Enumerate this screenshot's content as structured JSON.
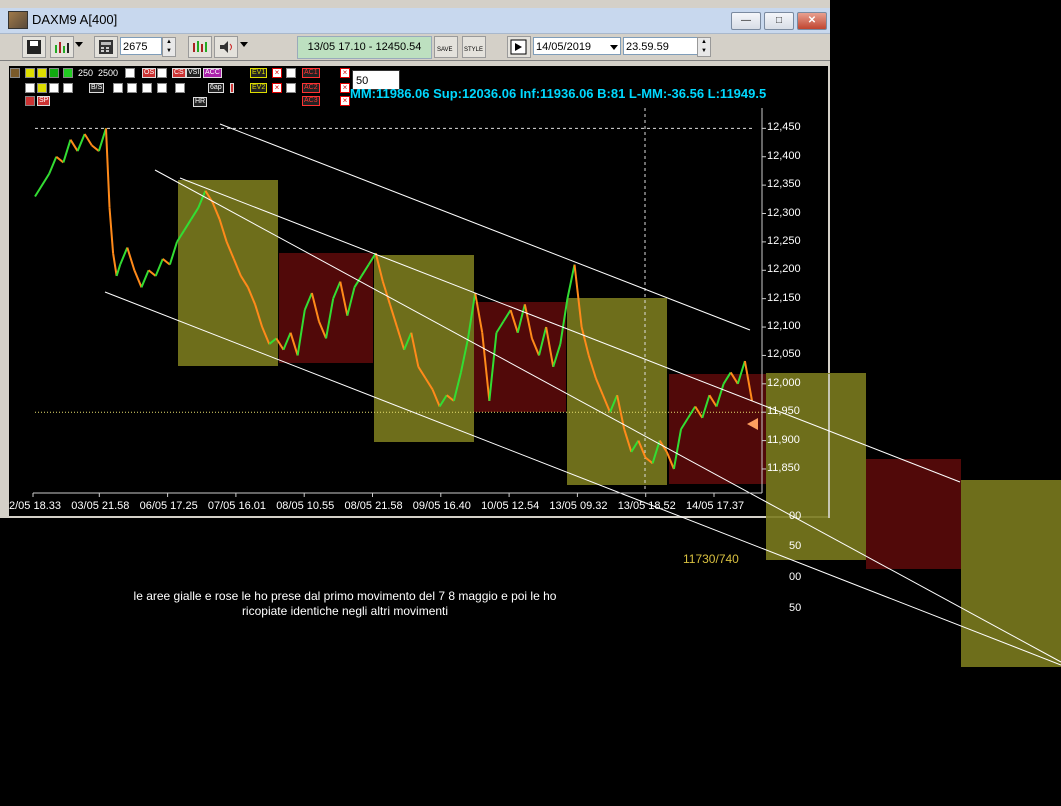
{
  "window": {
    "title": "DAXM9 A[400]",
    "min_label": "—",
    "max_label": "□",
    "close_label": "✕"
  },
  "toolbar": {
    "bars_value": "2675",
    "bar_info": "13/05 17.10 - 12450.54",
    "date_value": "14/05/2019",
    "time_value": "23.59.59",
    "save_label": "SAVE",
    "style_label": "STYLE"
  },
  "indicators": {
    "row1": [
      "250",
      "2500"
    ],
    "labels": [
      "OS",
      "CS",
      "68",
      "VSI",
      "ACC",
      "EV1",
      "AC1"
    ],
    "labels2": [
      "B/S",
      "6ap",
      "HR",
      "EV2",
      "AC2",
      "AC3",
      "SP"
    ],
    "period_value": "50"
  },
  "info_line": "MM:11986.06 Sup:12036.06 Inf:11936.06 B:81 L-MM:-36.56 L:11949.5",
  "annotation": {
    "line1": "le aree gialle e rose le ho prese dal primo movimento del 7 8 maggio e poi le ho",
    "line2": "ricopiate identiche negli altri movimenti"
  },
  "ratio_label": "11730/740",
  "extra_labels": [
    "00",
    "50",
    "00",
    "50"
  ],
  "colors": {
    "background": "#000000",
    "yellow_zone": "#7a7a1e",
    "red_zone": "#5a0a0a",
    "price_up": "#33dd33",
    "price_down": "#ff8a1a",
    "channel": "#ffffff",
    "info_text": "#00d8ff"
  },
  "chart_data": {
    "type": "line",
    "symbol": "DAXM9",
    "ylim": [
      11820,
      12470
    ],
    "y_ticks": [
      12450,
      12400,
      12350,
      12300,
      12250,
      12200,
      12150,
      12100,
      12050,
      12000,
      11950,
      11900,
      11850
    ],
    "y_tick_labels": [
      "12,450",
      "12,400",
      "12,350",
      "12,300",
      "12,250",
      "12,200",
      "12,150",
      "12,100",
      "12,050",
      "12,000",
      "11,950",
      "11,900",
      "11,850"
    ],
    "x_tick_labels": [
      "2/05 18.33",
      "03/05 21.58",
      "06/05 17.25",
      "07/05 16.01",
      "08/05 10.55",
      "08/05 21.58",
      "09/05 16.40",
      "10/05 12.54",
      "13/05 09.32",
      "13/05 18.52",
      "14/05 17.37"
    ],
    "series": [
      {
        "points": [
          [
            0,
            12330
          ],
          [
            2,
            12370
          ],
          [
            3,
            12400
          ],
          [
            4,
            12390
          ],
          [
            5,
            12430
          ],
          [
            6,
            12410
          ],
          [
            7,
            12440
          ],
          [
            8,
            12420
          ],
          [
            9,
            12410
          ],
          [
            10,
            12450
          ],
          [
            10.5,
            12310
          ],
          [
            11,
            12230
          ],
          [
            11.5,
            12190
          ],
          [
            12,
            12210
          ],
          [
            13,
            12240
          ],
          [
            14,
            12200
          ],
          [
            15,
            12170
          ],
          [
            16,
            12200
          ],
          [
            17,
            12190
          ],
          [
            18,
            12220
          ],
          [
            19,
            12210
          ],
          [
            20,
            12250
          ],
          [
            21,
            12270
          ],
          [
            22,
            12290
          ],
          [
            23,
            12310
          ],
          [
            24,
            12340
          ],
          [
            25,
            12320
          ],
          [
            26,
            12290
          ],
          [
            27,
            12250
          ],
          [
            28,
            12220
          ],
          [
            29,
            12190
          ],
          [
            30,
            12170
          ],
          [
            31,
            12140
          ],
          [
            32,
            12100
          ],
          [
            33,
            12070
          ],
          [
            34,
            12080
          ],
          [
            35,
            12060
          ],
          [
            36,
            12090
          ],
          [
            37,
            12050
          ],
          [
            38,
            12130
          ],
          [
            39,
            12160
          ],
          [
            40,
            12110
          ],
          [
            41,
            12080
          ],
          [
            42,
            12150
          ],
          [
            43,
            12180
          ],
          [
            44,
            12120
          ],
          [
            45,
            12170
          ],
          [
            46,
            12190
          ],
          [
            47,
            12210
          ],
          [
            48,
            12230
          ],
          [
            49,
            12180
          ],
          [
            50,
            12140
          ],
          [
            51,
            12100
          ],
          [
            52,
            12060
          ],
          [
            53,
            12090
          ],
          [
            54,
            12030
          ],
          [
            55,
            12010
          ],
          [
            56,
            11990
          ],
          [
            57,
            11960
          ],
          [
            58,
            11980
          ],
          [
            59,
            11970
          ],
          [
            60,
            12020
          ],
          [
            61,
            12080
          ],
          [
            62,
            12160
          ],
          [
            63,
            12090
          ],
          [
            64,
            11970
          ],
          [
            65,
            12090
          ],
          [
            66,
            12110
          ],
          [
            67,
            12130
          ],
          [
            68,
            12090
          ],
          [
            69,
            12140
          ],
          [
            70,
            12080
          ],
          [
            71,
            12050
          ],
          [
            72,
            12100
          ],
          [
            73,
            12030
          ],
          [
            74,
            12070
          ],
          [
            75,
            12150
          ],
          [
            76,
            12210
          ],
          [
            77,
            12100
          ],
          [
            78,
            12050
          ],
          [
            79,
            12010
          ],
          [
            80,
            11980
          ],
          [
            81,
            11950
          ],
          [
            82,
            11980
          ],
          [
            83,
            11920
          ],
          [
            84,
            11880
          ],
          [
            85,
            11900
          ],
          [
            86,
            11870
          ],
          [
            87,
            11860
          ],
          [
            88,
            11900
          ],
          [
            89,
            11880
          ],
          [
            90,
            11850
          ],
          [
            91,
            11920
          ],
          [
            92,
            11940
          ],
          [
            93,
            11960
          ],
          [
            94,
            11940
          ],
          [
            95,
            11980
          ],
          [
            96,
            11960
          ],
          [
            97,
            12000
          ],
          [
            98,
            12020
          ],
          [
            99,
            12000
          ],
          [
            100,
            12040
          ],
          [
            101,
            11970
          ]
        ]
      }
    ],
    "reference_lines": {
      "dashed_high": 12450,
      "dotted_current": 11950
    }
  }
}
